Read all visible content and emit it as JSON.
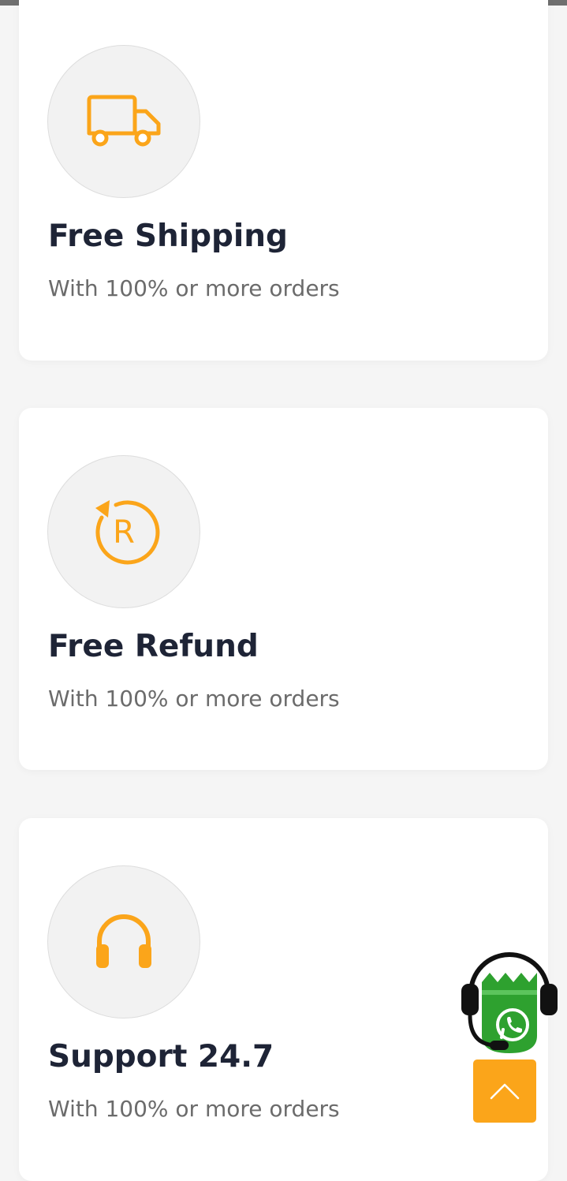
{
  "features": [
    {
      "title": "Free Shipping",
      "subtitle": "With 100% or more orders",
      "icon": "truck-icon"
    },
    {
      "title": "Free Refund",
      "subtitle": "With 100% or more orders",
      "icon": "refund-icon",
      "icon_letter": "R"
    },
    {
      "title": "Support 24.7",
      "subtitle": "With 100% or more orders",
      "icon": "headphones-icon"
    }
  ],
  "floating": {
    "whatsapp_icon": "whatsapp-support-icon",
    "scroll_top_icon": "chevron-up-icon"
  },
  "colors": {
    "accent": "#fba51a",
    "title_text": "#1e2436",
    "subtitle_text": "#6b6b6b",
    "whatsapp_green": "#2ea12f",
    "icon_circle_bg": "#f2f2f2"
  }
}
